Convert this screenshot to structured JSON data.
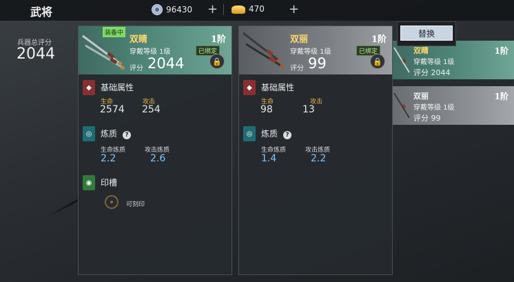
{
  "header": {
    "title": "武将",
    "silver": "96430",
    "gold": "470"
  },
  "summary": {
    "label": "兵器总评分",
    "value": "2044"
  },
  "equipped": {
    "tag": "装备中",
    "name": "双睛",
    "tier": "1阶",
    "level": "穿戴等级 1级",
    "bound": "已绑定",
    "score_label": "评分",
    "score": "2044",
    "base_title": "基础属性",
    "hp_label": "生命",
    "hp": "2574",
    "atk_label": "攻击",
    "atk": "254",
    "refine_title": "炼质",
    "refine_hp_label": "生命炼质",
    "refine_hp": "2.2",
    "refine_atk_label": "攻击炼质",
    "refine_atk": "2.6",
    "seal_title": "印槽",
    "seal_text": "可刻印"
  },
  "candidate": {
    "name": "双丽",
    "tier": "1阶",
    "level": "穿戴等级 1级",
    "bound": "已绑定",
    "score_label": "评分",
    "score": "99",
    "base_title": "基础属性",
    "hp_label": "生命",
    "hp": "98",
    "atk_label": "攻击",
    "atk": "13",
    "refine_title": "炼质",
    "refine_hp_label": "生命炼质",
    "refine_hp": "1.4",
    "refine_atk_label": "攻击炼质",
    "refine_atk": "2.2"
  },
  "replace_label": "替换",
  "list": [
    {
      "name": "双睛",
      "tier": "1阶",
      "level": "穿戴等级 1级",
      "score": "评分 2044"
    },
    {
      "name": "双丽",
      "tier": "1阶",
      "level": "穿戴等级 1级",
      "score": "评分 99"
    }
  ],
  "colors": {
    "equipped_card": "#4f8678",
    "candidate_card": "#7a7e83",
    "quality_name": "#ffd86b",
    "refine_value": "#7cc6ff",
    "stat_label": "#e7b44a"
  }
}
